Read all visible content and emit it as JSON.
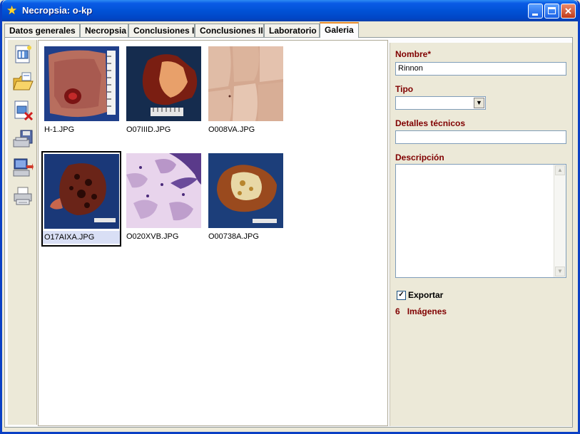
{
  "window": {
    "title": "Necropsia: o-kp"
  },
  "tabs": [
    "Datos generales",
    "Necropsia",
    "Conclusiones I",
    "Conclusiones II",
    "Laboratorio",
    "Galeria"
  ],
  "active_tab": "Galeria",
  "toolbar": {
    "icons": [
      "new-image-icon",
      "open-folder-icon",
      "delete-image-icon",
      "save-disk-icon",
      "export-computer-icon",
      "printer-icon"
    ]
  },
  "gallery": {
    "items": [
      {
        "filename": "H-1.JPG",
        "selected": false
      },
      {
        "filename": "O07IIID.JPG",
        "selected": false
      },
      {
        "filename": "O008VA.JPG",
        "selected": false
      },
      {
        "filename": "O17AIXA.JPG",
        "selected": true
      },
      {
        "filename": "O020XVB.JPG",
        "selected": false
      },
      {
        "filename": "O00738A.JPG",
        "selected": false
      }
    ]
  },
  "details": {
    "nombre_label": "Nombre*",
    "nombre_value": "Rinnon",
    "tipo_label": "Tipo",
    "tipo_value": "",
    "detalles_label": "Detalles técnicos",
    "detalles_value": "",
    "descripcion_label": "Descripción",
    "descripcion_value": "",
    "exportar_label": "Exportar",
    "exportar_checked": true,
    "image_count": "6",
    "image_count_label": "Imágenes"
  },
  "colors": {
    "title_bar": "#0152D6",
    "label": "#800000",
    "tab_active_accent": "#E68B2C"
  }
}
